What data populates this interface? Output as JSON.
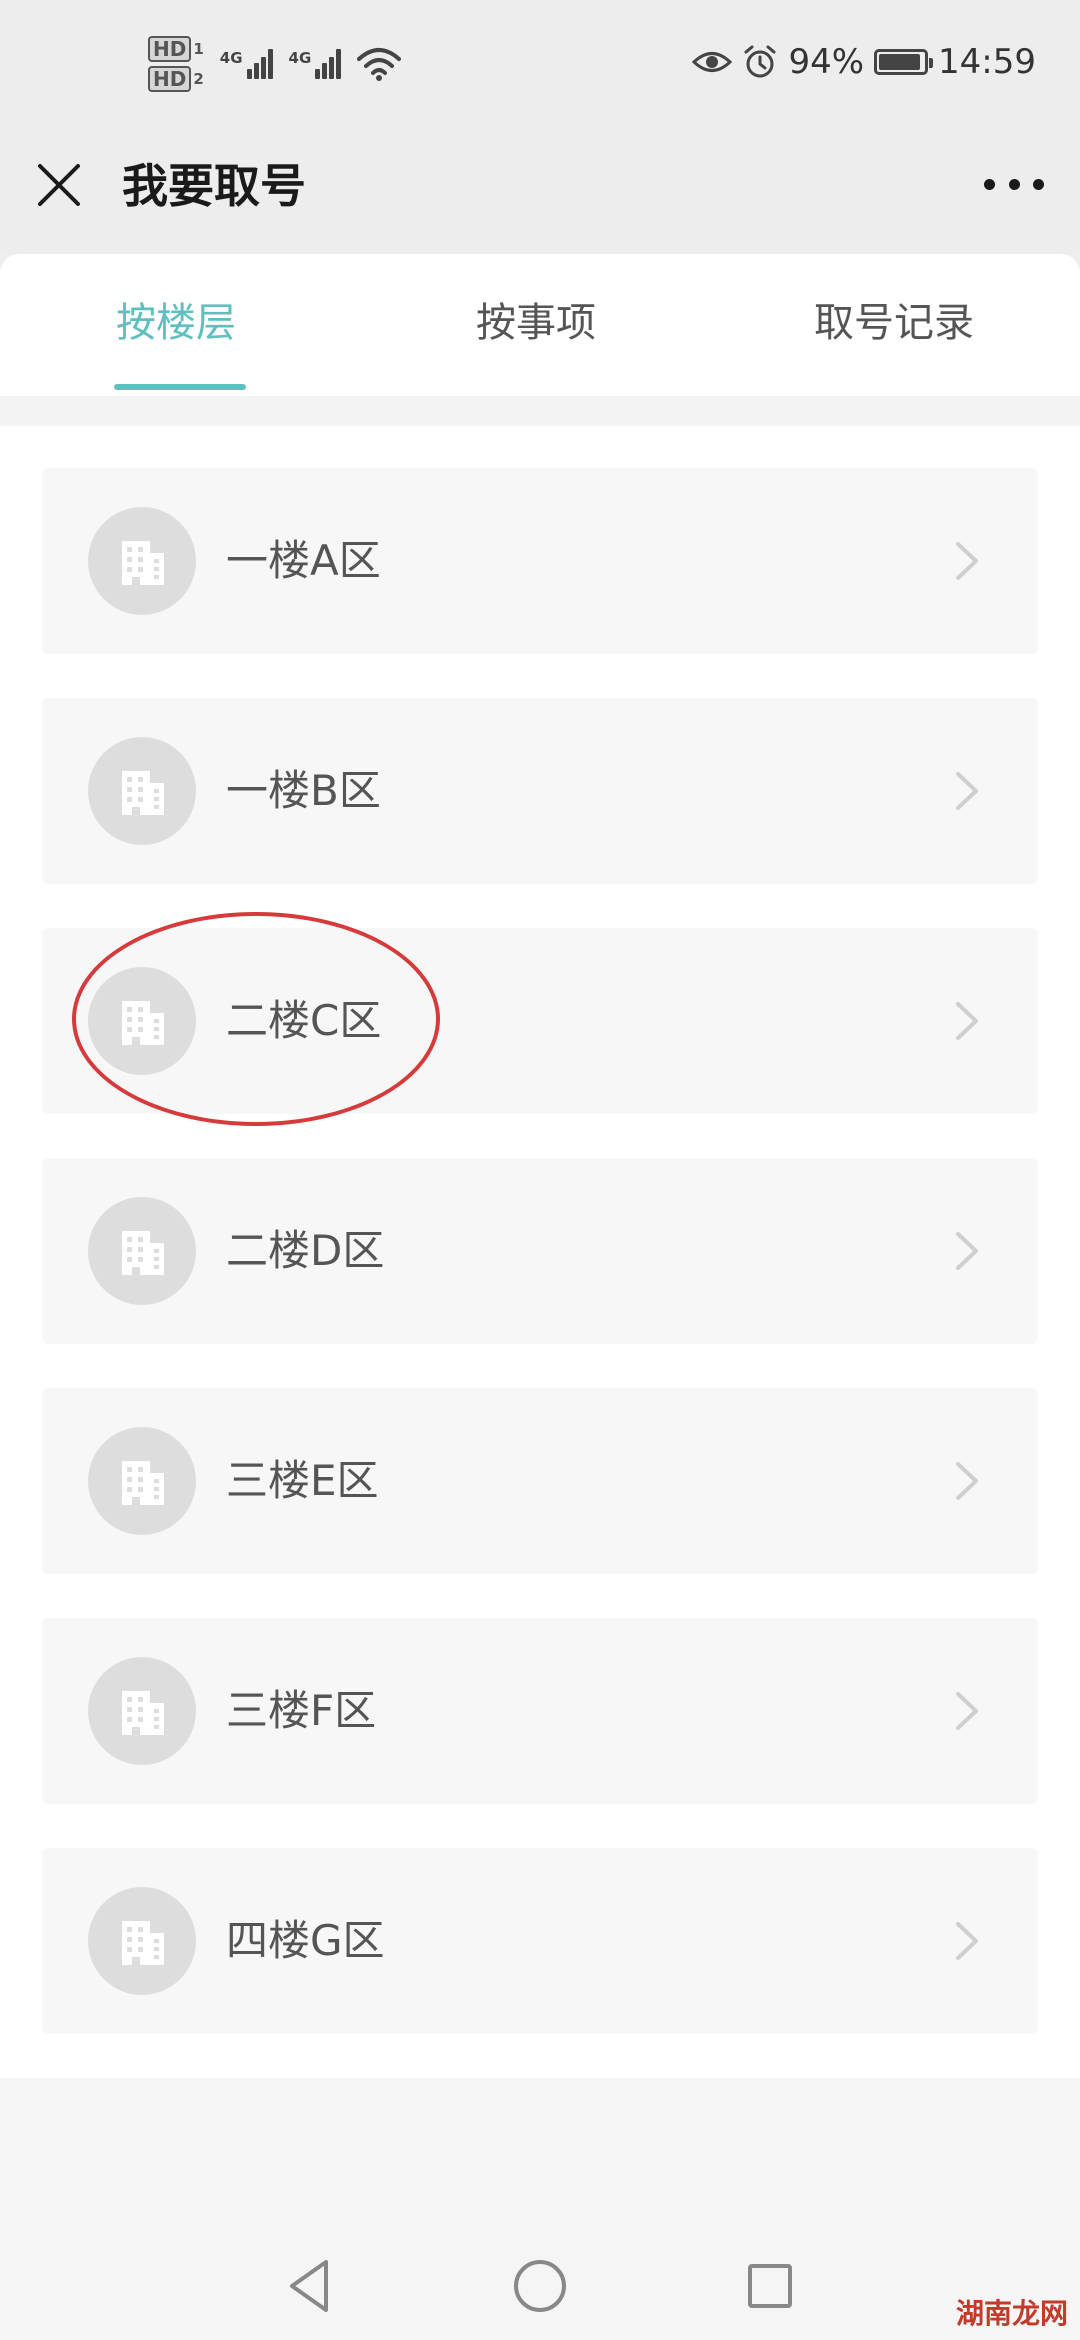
{
  "status_bar": {
    "hd1": "HD",
    "hd1_sim": "1",
    "hd2": "HD",
    "hd2_sim": "2",
    "net1": "4G",
    "net2": "4G",
    "battery_pct": "94%",
    "battery_level": 0.94,
    "time": "14:59"
  },
  "header": {
    "title": "我要取号"
  },
  "tabs": [
    {
      "label": "按楼层",
      "active": true
    },
    {
      "label": "按事项",
      "active": false
    },
    {
      "label": "取号记录",
      "active": false
    }
  ],
  "floors": [
    {
      "label": "一楼A区"
    },
    {
      "label": "一楼B区"
    },
    {
      "label": "二楼C区",
      "highlighted": true
    },
    {
      "label": "二楼D区"
    },
    {
      "label": "三楼E区"
    },
    {
      "label": "三楼F区"
    },
    {
      "label": "四楼G区"
    }
  ],
  "colors": {
    "accent": "#5fbfbf",
    "highlight_circle": "#d63a3a"
  },
  "watermark": "湖南龙网"
}
